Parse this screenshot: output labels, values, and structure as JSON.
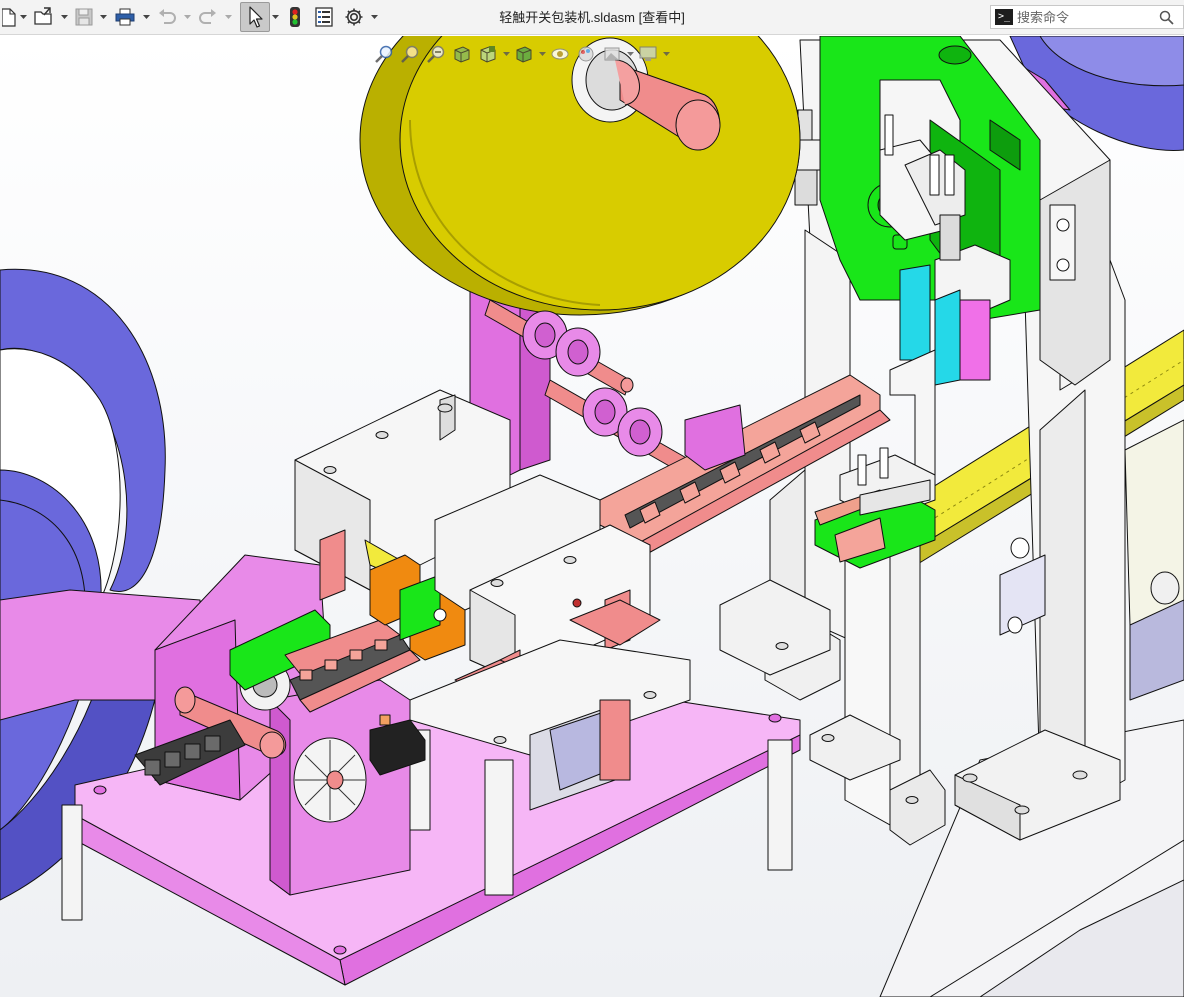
{
  "window": {
    "title": "轻触开关包装机.sldasm [查看中]"
  },
  "toolbar": {
    "items": [
      {
        "name": "new-document",
        "icon": "new-doc-icon"
      },
      {
        "name": "open",
        "icon": "open-folder-icon"
      },
      {
        "name": "save",
        "icon": "save-icon"
      },
      {
        "name": "print",
        "icon": "print-icon"
      },
      {
        "name": "undo",
        "icon": "undo-icon"
      },
      {
        "name": "redo",
        "icon": "redo-icon"
      },
      {
        "name": "select",
        "icon": "cursor-arrow-icon"
      },
      {
        "name": "rebuild",
        "icon": "traffic-light-icon"
      },
      {
        "name": "file-properties",
        "icon": "file-properties-icon"
      },
      {
        "name": "options",
        "icon": "gear-icon"
      }
    ]
  },
  "command_search": {
    "prompt": ">_",
    "placeholder": "搜索命令"
  },
  "heads_up_toolbar": {
    "items": [
      {
        "name": "zoom-to-fit",
        "icon": "zoom-fit-icon"
      },
      {
        "name": "zoom-to-area",
        "icon": "zoom-area-icon"
      },
      {
        "name": "previous-view",
        "icon": "previous-view-icon"
      },
      {
        "name": "section-view",
        "icon": "section-view-icon"
      },
      {
        "name": "view-orientation",
        "icon": "view-cube-icon"
      },
      {
        "name": "display-style",
        "icon": "display-style-icon"
      },
      {
        "name": "hide-show-items",
        "icon": "eye-icon"
      },
      {
        "name": "edit-appearance",
        "icon": "appearance-icon"
      },
      {
        "name": "apply-scene",
        "icon": "scene-icon"
      },
      {
        "name": "view-settings",
        "icon": "monitor-icon"
      }
    ]
  },
  "colors": {
    "titlebar_bg": "#f3f3f3",
    "reel_yellow": "#d8cc00",
    "frame_magenta": "#e070e0",
    "base_pink": "#f6b6f6",
    "reel_blue": "#6a68dc",
    "bracket_green": "#19e619",
    "salmon": "#f08c8c",
    "orange": "#f08a10",
    "cyan": "#25d8e8",
    "rail_yellow": "#f2ea3c",
    "white_part": "#f6f6f6",
    "tape_salmon": "#f4a49a"
  }
}
